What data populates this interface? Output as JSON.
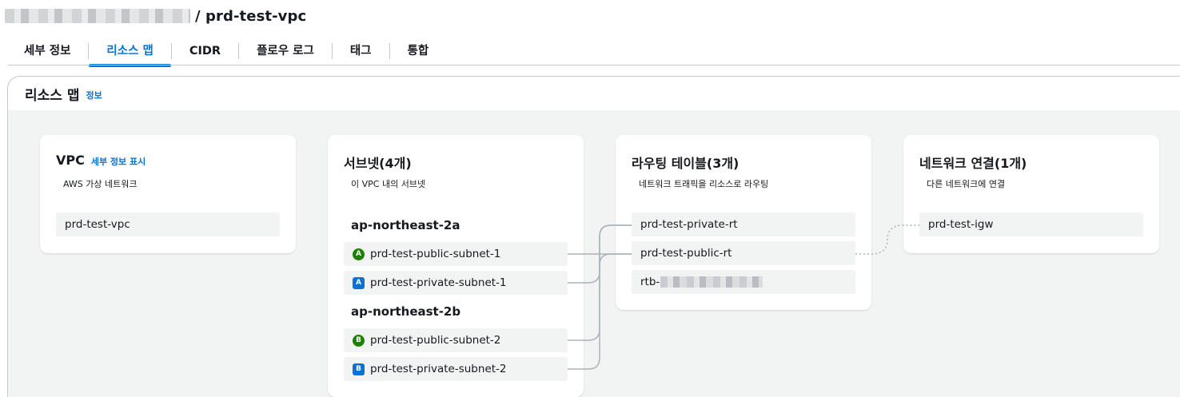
{
  "header": {
    "title": "/ prd-test-vpc"
  },
  "tabs": [
    {
      "label": "세부 정보",
      "active": false
    },
    {
      "label": "리소스 맵",
      "active": true
    },
    {
      "label": "CIDR",
      "active": false
    },
    {
      "label": "플로우 로그",
      "active": false
    },
    {
      "label": "태그",
      "active": false
    },
    {
      "label": "통합",
      "active": false
    }
  ],
  "container": {
    "title": "리소스 맵",
    "info_link": "정보"
  },
  "vpc_card": {
    "title": "VPC",
    "link": "세부 정보 표시",
    "description": "AWS 가상 네트워크",
    "items": [
      "prd-test-vpc"
    ]
  },
  "subnet_card": {
    "title": "서브넷(4개)",
    "description": "이 VPC 내의 서브넷",
    "groups": [
      {
        "az": "ap-northeast-2a",
        "subnets": [
          {
            "badge": "A",
            "type": "public",
            "name": "prd-test-public-subnet-1"
          },
          {
            "badge": "A",
            "type": "private",
            "name": "prd-test-private-subnet-1"
          }
        ]
      },
      {
        "az": "ap-northeast-2b",
        "subnets": [
          {
            "badge": "B",
            "type": "public",
            "name": "prd-test-public-subnet-2"
          },
          {
            "badge": "B",
            "type": "private",
            "name": "prd-test-private-subnet-2"
          }
        ]
      }
    ]
  },
  "route_card": {
    "title": "라우팅 테이블(3개)",
    "description": "네트워크 트래픽을 리소스로 라우팅",
    "items": [
      "prd-test-private-rt",
      "prd-test-public-rt",
      "rtb-"
    ]
  },
  "network_card": {
    "title": "네트워크 연결(1개)",
    "description": "다른 네트워크에 연결",
    "items": [
      "prd-test-igw"
    ]
  },
  "colors": {
    "accent": "#0972d3",
    "public_badge": "#1d8102",
    "private_badge": "#0972d3",
    "connector": "#aab2ba"
  }
}
